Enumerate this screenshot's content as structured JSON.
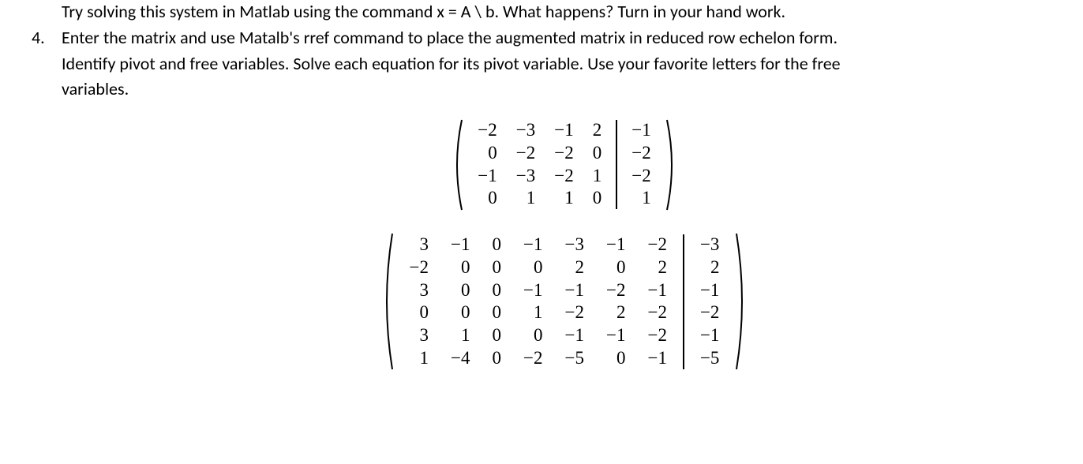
{
  "intro_line": "Try solving this system in Matlab using the command x = A \\ b. What happens? Turn in your hand work.",
  "item_number": "4.",
  "item_text_line1": "Enter the matrix and use Matalb's rref command to place the augmented matrix in reduced row echelon form.",
  "item_text_line2": "Identify pivot and free variables. Solve each equation for its pivot variable. Use your favorite letters for the free",
  "item_text_line3": "variables.",
  "matrix1": {
    "left": [
      [
        "−2",
        "−3",
        "−1",
        "2"
      ],
      [
        "0",
        "−2",
        "−2",
        "0"
      ],
      [
        "−1",
        "−3",
        "−2",
        "1"
      ],
      [
        "0",
        "1",
        "1",
        "0"
      ]
    ],
    "right": [
      [
        "−1"
      ],
      [
        "−2"
      ],
      [
        "−2"
      ],
      [
        "1"
      ]
    ]
  },
  "matrix2": {
    "left": [
      [
        "3",
        "−1",
        "0",
        "−1",
        "−3",
        "−1",
        "−2"
      ],
      [
        "−2",
        "0",
        "0",
        "0",
        "2",
        "0",
        "2"
      ],
      [
        "3",
        "0",
        "0",
        "−1",
        "−1",
        "−2",
        "−1"
      ],
      [
        "0",
        "0",
        "0",
        "1",
        "−2",
        "2",
        "−2"
      ],
      [
        "3",
        "1",
        "0",
        "0",
        "−1",
        "−1",
        "−2"
      ],
      [
        "1",
        "−4",
        "0",
        "−2",
        "−5",
        "0",
        "−1"
      ]
    ],
    "right": [
      [
        "−3"
      ],
      [
        "2"
      ],
      [
        "−1"
      ],
      [
        "−2"
      ],
      [
        "−1"
      ],
      [
        "−5"
      ]
    ]
  }
}
